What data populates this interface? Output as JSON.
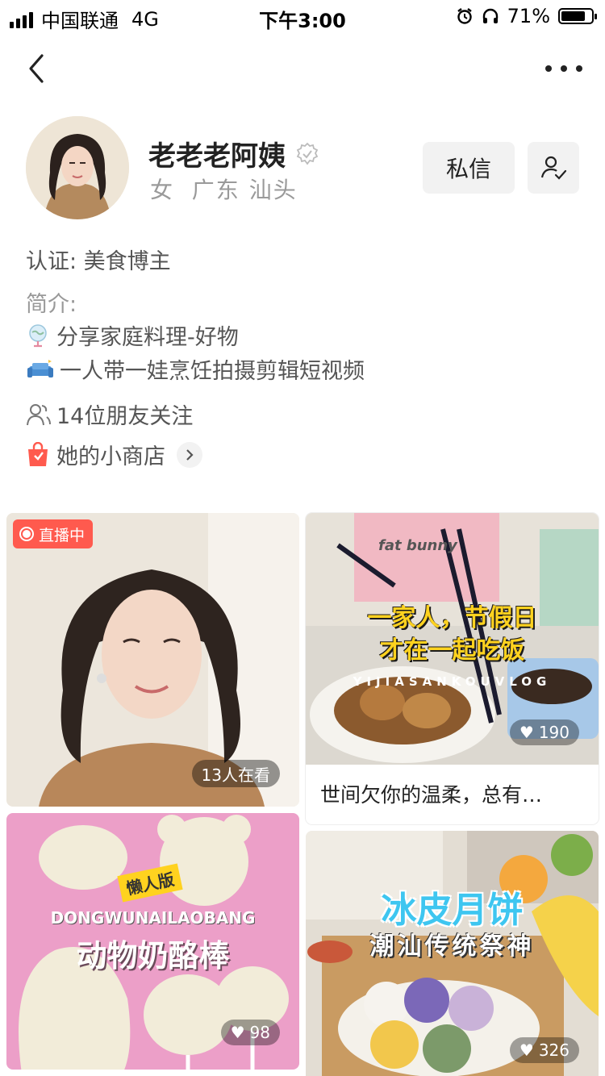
{
  "status_bar": {
    "carrier": "中国联通",
    "network": "4G",
    "time": "下午3:00",
    "battery": "71%"
  },
  "profile": {
    "name": "老老老阿姨",
    "gender_location": "女  广东 汕头",
    "message_button": "私信",
    "certification_label": "认证: 美食博主",
    "intro_label": "简介:",
    "intro_lines": [
      "分享家庭料理-好物",
      "一人带一娃烹饪拍摄剪辑短视频"
    ],
    "friends_following": "14位朋友关注",
    "shop": "她的小商店"
  },
  "feed": {
    "live": {
      "badge": "直播中",
      "watchers": "13人在看"
    },
    "post1": {
      "overlay_line1": "一家人，节假日",
      "overlay_line2": "才在一起吃饭",
      "overlay_small": "YIJIASANKOUVLOG",
      "apron_text": "fat bunny",
      "likes": "190",
      "caption": "世间欠你的温柔，总有…"
    },
    "post2": {
      "tag": "懒人版",
      "overlay_small": "DONGWUNAILAOBANG",
      "overlay_title": "动物奶酪棒",
      "likes": "98"
    },
    "post3": {
      "overlay_title": "冰皮月饼",
      "overlay_subtitle": "潮汕传统祭神",
      "likes": "326"
    }
  },
  "colors": {
    "accent_red": "#ff5a4e",
    "button_bg": "#f2f2f2",
    "muted_text": "#9a9a9a"
  }
}
